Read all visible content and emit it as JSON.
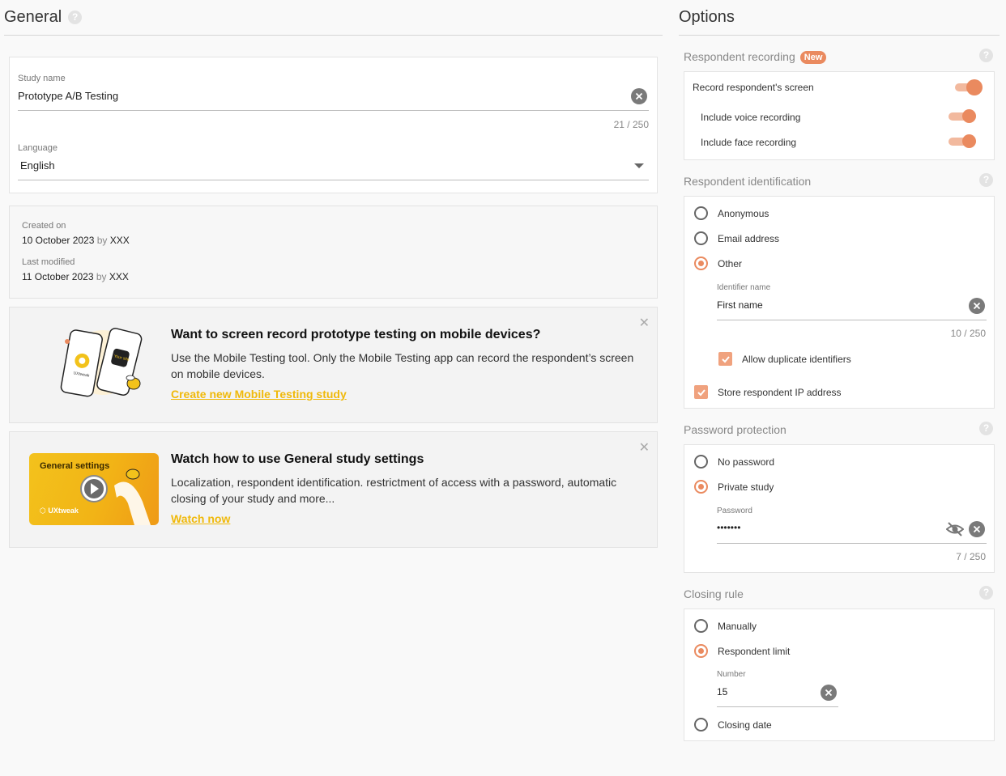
{
  "general": {
    "title": "General",
    "study_name_label": "Study name",
    "study_name_value": "Prototype A/B Testing",
    "study_name_counter": "21 / 250",
    "language_label": "Language",
    "language_value": "English",
    "created_label": "Created on",
    "created_date": "10 October 2023",
    "created_by_word": "by",
    "created_by": "XXX",
    "modified_label": "Last modified",
    "modified_date": "11 October 2023",
    "modified_by_word": "by",
    "modified_by": "XXX"
  },
  "promo_mobile": {
    "title": "Want to screen record prototype testing on mobile devices?",
    "text": "Use the Mobile Testing tool. Only the Mobile Testing app can record the respondent’s screen on mobile devices.",
    "link": "Create new Mobile Testing study",
    "phone_right_text": "Your site",
    "phone_left_text": "UXtweak"
  },
  "promo_video": {
    "title": "Watch how to use General study settings",
    "text": "Localization, respondent identification. restrictment of access with a password, automatic closing of your study and more...",
    "link": "Watch now",
    "thumb_title": "General settings",
    "thumb_brand": "UXtweak"
  },
  "options": {
    "title": "Options",
    "recording": {
      "title": "Respondent recording",
      "badge": "New",
      "record_screen": "Record respondent's screen",
      "voice": "Include voice recording",
      "face": "Include face recording"
    },
    "identification": {
      "title": "Respondent identification",
      "anonymous": "Anonymous",
      "email": "Email address",
      "other": "Other",
      "identifier_label": "Identifier name",
      "identifier_value": "First name",
      "identifier_counter": "10 / 250",
      "allow_duplicates": "Allow duplicate identifiers",
      "store_ip": "Store respondent IP address"
    },
    "password": {
      "title": "Password protection",
      "no_password": "No password",
      "private": "Private study",
      "password_label": "Password",
      "password_value": "•••••••",
      "password_counter": "7 / 250"
    },
    "closing": {
      "title": "Closing rule",
      "manually": "Manually",
      "limit": "Respondent limit",
      "number_label": "Number",
      "number_value": "15",
      "closing_date": "Closing date"
    }
  },
  "colors": {
    "accent": "#ea8a5f",
    "link_yellow": "#f0b90a"
  }
}
